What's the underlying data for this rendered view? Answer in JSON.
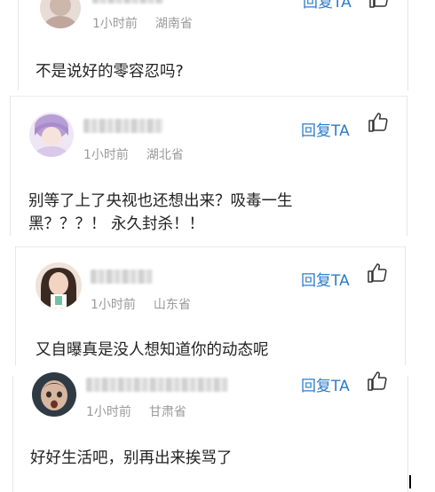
{
  "comments": [
    {
      "time": "1小时前",
      "location": "湖南省",
      "reply_label": "回复TA",
      "text": "不是说好的零容忍吗?"
    },
    {
      "time": "1小时前",
      "location": "湖北省",
      "reply_label": "回复TA",
      "text_line1": "别等了上了央视也还想出来？吸毒一生",
      "text_line2": "黑？？？！ 永久封杀！！"
    },
    {
      "time": "1小时前",
      "location": "山东省",
      "reply_label": "回复TA",
      "text": "又自曝真是没人想知道你的动态呢"
    },
    {
      "time": "1小时前",
      "location": "甘肃省",
      "reply_label": "回复TA",
      "text": "好好生活吧，别再出来挨骂了"
    }
  ],
  "colors": {
    "reply_link": "#2e7cc9",
    "meta_text": "#9a9a9a",
    "comment_text": "#222222"
  },
  "icons": [
    "thumbs-up-icon",
    "avatar"
  ]
}
